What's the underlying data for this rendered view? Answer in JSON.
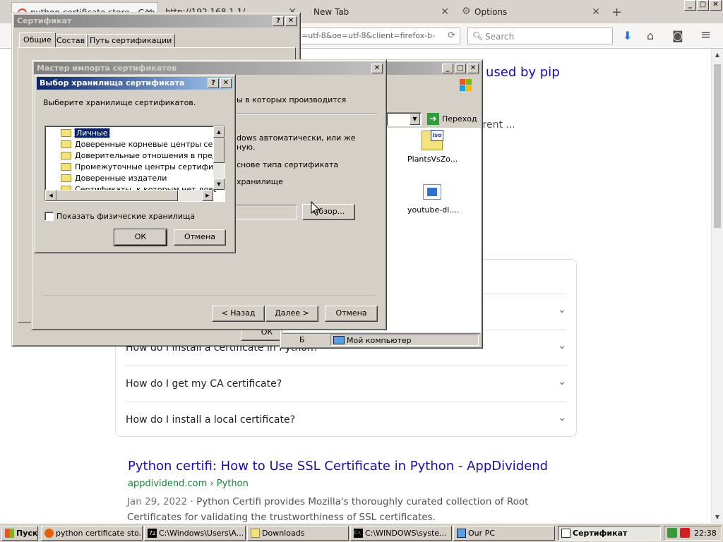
{
  "browser": {
    "tabs": [
      {
        "label": "python certificate store - Goo"
      },
      {
        "label": "http://192.168.1.1/"
      },
      {
        "label": "New Tab"
      },
      {
        "label": "Options"
      }
    ],
    "new_tab_symbol": "+",
    "url_text": "=utf-8&oe=utf-8&client=firefox-b-",
    "search_placeholder": "Search",
    "window_controls": [
      "_",
      "□",
      "✕"
    ]
  },
  "web": {
    "title_fragment": "used by pip",
    "snippet_fragment": "rrent ...",
    "paa_questions": [
      "How do I install a certificate in Python?",
      "How do I get my CA certificate?",
      "How do I install a local certificate?"
    ],
    "result": {
      "title": "Python certifi: How to Use SSL Certificate in Python - AppDividend",
      "url": "appdividend.com › Python",
      "date": "Jan 29, 2022 · ",
      "snippet": "Python Certifi provides Mozilla's thoroughly curated collection of Root Certificates for validating the trustworthiness of SSL certificates."
    }
  },
  "cert_dialog": {
    "title": "Сертификат",
    "tabs": [
      "Общие",
      "Состав",
      "Путь сертификации"
    ],
    "ok": "ОК"
  },
  "explorer": {
    "go_label": "Переход",
    "files": [
      {
        "name": "PlantsVsZo..."
      },
      {
        "name": "youtube-dl...."
      }
    ],
    "status_left": "Б",
    "status_computer": "Мой компьютер"
  },
  "wizard": {
    "title": "Мастер импорта сертификатов",
    "frag_top": "ы в которых производится",
    "frag_auto": "dows автоматически, или же",
    "frag_auto2": "ную.",
    "frag_type": "снове типа сертификата",
    "frag_store": "хранилище",
    "browse": "Обзор...",
    "back": "< Назад",
    "next": "Далее >",
    "cancel": "Отмена"
  },
  "store_dialog": {
    "title": "Выбор хранилища сертификата",
    "prompt": "Выберите хранилище сертификатов.",
    "stores": [
      "Личные",
      "Доверенные корневые центры сертификации",
      "Доверительные отношения в предприятии",
      "Промежуточные центры сертификации",
      "Доверенные издатели",
      "Сертификаты, к которым нет доверия"
    ],
    "selected_index": 0,
    "show_physical": "Показать физические хранилища",
    "show_physical_checked": false,
    "ok": "ОК",
    "cancel": "Отмена"
  },
  "taskbar": {
    "start": "Пуск",
    "tasks": [
      {
        "label": "python certificate sto..."
      },
      {
        "label": "C:\\Windows\\Users\\A..."
      },
      {
        "label": "Downloads"
      },
      {
        "label": "C:\\WINDOWS\\syste..."
      },
      {
        "label": "Our PC"
      },
      {
        "label": "Сертификат"
      }
    ],
    "clock": "22:38"
  },
  "colors": {
    "link": "#1a0dab",
    "url_green": "#188038",
    "titlebar_active": "#0a246a",
    "win_face": "#d4d0c8"
  }
}
